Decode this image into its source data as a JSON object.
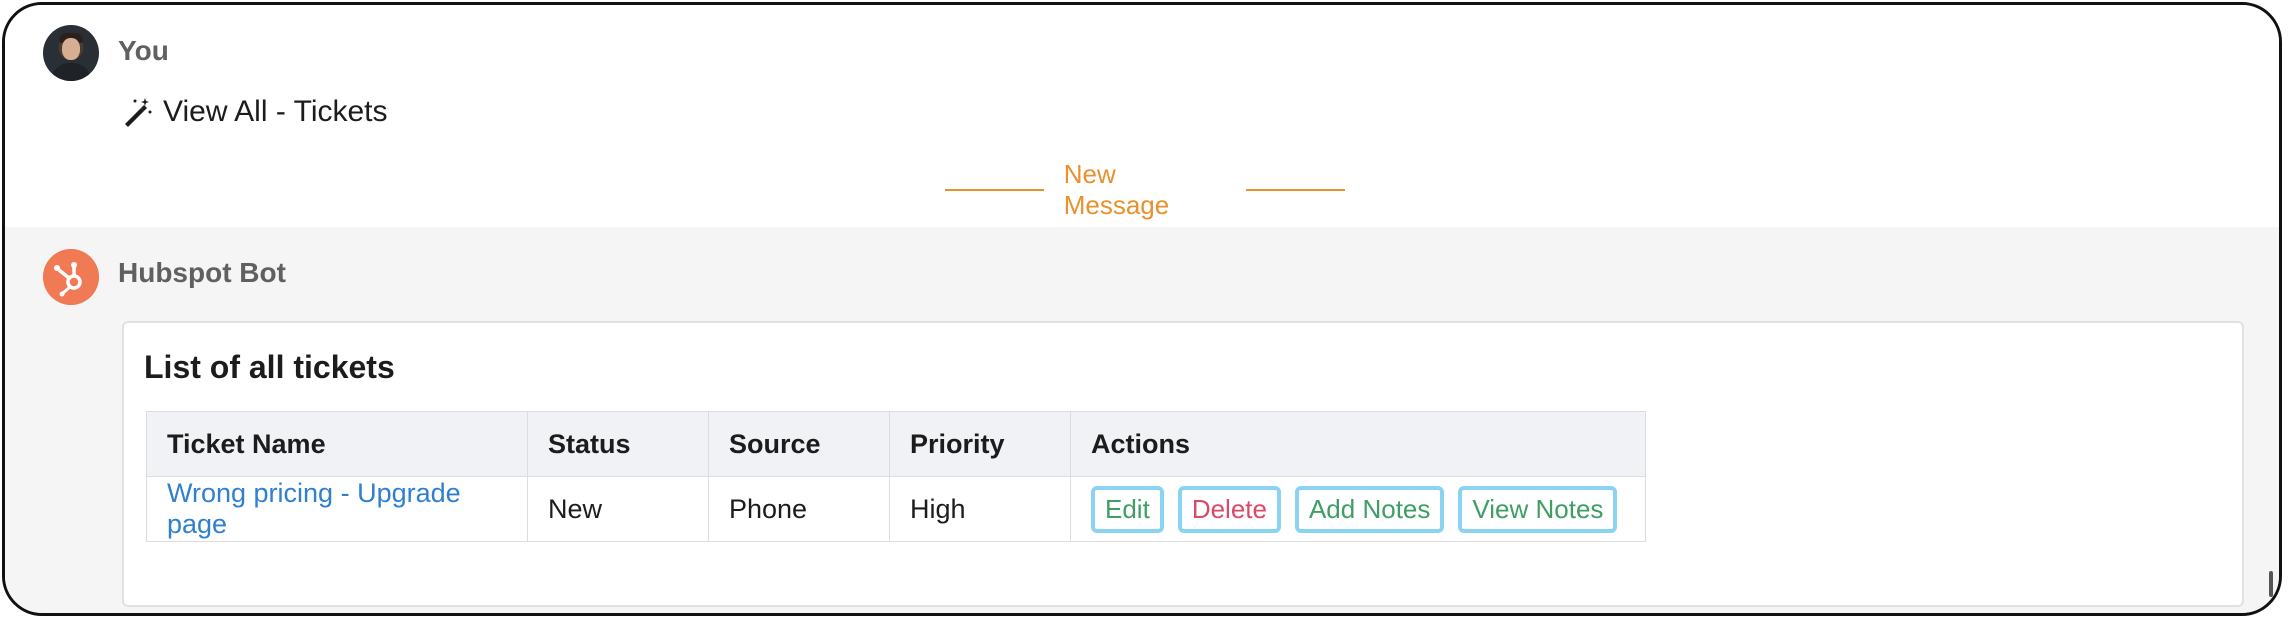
{
  "messages": {
    "user": {
      "name": "You",
      "command": "View All - Tickets"
    },
    "divider_label": "New Message",
    "bot": {
      "name": "Hubspot Bot"
    }
  },
  "card": {
    "title": "List of all tickets",
    "columns": [
      "Ticket Name",
      "Status",
      "Source",
      "Priority",
      "Actions"
    ],
    "rows": [
      {
        "ticket_name": "Wrong pricing - Upgrade page",
        "status": "New",
        "source": "Phone",
        "priority": "High"
      }
    ],
    "actions": {
      "edit": "Edit",
      "delete": "Delete",
      "add_notes": "Add Notes",
      "view_notes": "View Notes"
    }
  },
  "icons": {
    "command": "magic-wand-icon",
    "bot_avatar": "hubspot-sprocket-icon"
  },
  "colors": {
    "divider": "#e8912d",
    "link": "#2f80cf",
    "bot_avatar": "#f07a54",
    "action_green": "#3f9e64",
    "action_red": "#d84a68",
    "button_focus_border": "#8ad3f2"
  }
}
